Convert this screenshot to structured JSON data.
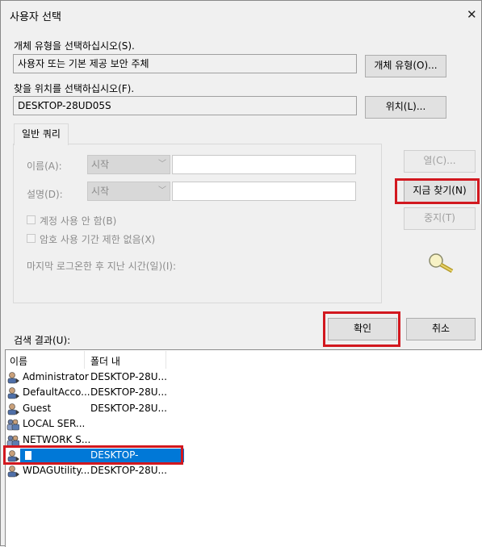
{
  "window": {
    "title": "사용자 선택"
  },
  "object_type": {
    "label": "개체 유형을 선택하십시오(S).",
    "value": "사용자 또는 기본 제공 보안 주체",
    "button": "개체 유형(O)..."
  },
  "location": {
    "label": "찾을 위치를 선택하십시오(F).",
    "value": "DESKTOP-28UD05S",
    "button": "위치(L)..."
  },
  "query": {
    "tab": "일반 쿼리",
    "name_label": "이름(A):",
    "name_mode": "시작",
    "desc_label": "설명(D):",
    "desc_mode": "시작",
    "disabled_accounts": "계정 사용 안 함(B)",
    "no_expire": "암호 사용 기간 제한 없음(X)",
    "last_logon": "마지막 로그온한 후 지난 시간(일)(I):"
  },
  "side_buttons": {
    "columns": "열(C)...",
    "find_now": "지금 찾기(N)",
    "stop": "중지(T)"
  },
  "ok": "확인",
  "cancel": "취소",
  "results": {
    "label": "검색 결과(U):",
    "columns": [
      "이름",
      "폴더 내"
    ],
    "rows": [
      {
        "name": "Administrator",
        "folder": "DESKTOP-28U..."
      },
      {
        "name": "DefaultAcco...",
        "folder": "DESKTOP-28U..."
      },
      {
        "name": "Guest",
        "folder": "DESKTOP-28U..."
      },
      {
        "name": "LOCAL SER...",
        "folder": ""
      },
      {
        "name": "NETWORK S...",
        "folder": ""
      },
      {
        "name": "",
        "folder": "DESKTOP-"
      },
      {
        "name": "WDAGUtility...",
        "folder": "DESKTOP-28U..."
      }
    ]
  },
  "colors": {
    "selection": "#0078d7",
    "highlight_box": "#d2181f"
  }
}
